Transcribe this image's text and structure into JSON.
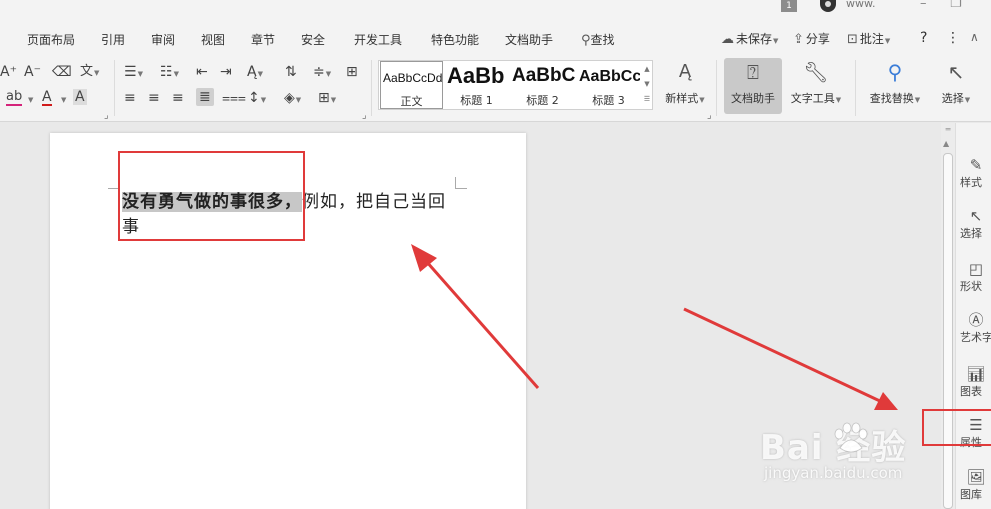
{
  "titlebar": {
    "tab_count": "1",
    "user_label": "www.",
    "minimize": "–",
    "restore": "❐"
  },
  "menu": {
    "items": [
      "页面布局",
      "引用",
      "审阅",
      "视图",
      "章节",
      "安全",
      "开发工具",
      "特色功能",
      "文档助手"
    ],
    "search_label": "查找",
    "save_status": "未保存",
    "share": "分享",
    "comment": "批注",
    "help": "?",
    "more": "⋮",
    "collapse": "∧"
  },
  "ribbon": {
    "font_tools": [
      "A⁺",
      "A⁻",
      "◇",
      "wén"
    ],
    "font_tools_row2": [
      "ab",
      "A",
      "A"
    ],
    "styles": [
      {
        "preview": "AaBbCcDd",
        "name": "正文",
        "selected": true
      },
      {
        "preview": "AaBb",
        "name": "标题 1"
      },
      {
        "preview": "AaBbC",
        "name": "标题 2"
      },
      {
        "preview": "AaBbCc",
        "name": "标题 3"
      }
    ],
    "new_style": "新样式",
    "doc_assistant": "文档助手",
    "text_tools": "文字工具",
    "find_replace": "查找替换",
    "select": "选择"
  },
  "document": {
    "bold_text": "没有勇气做的事很多，",
    "normal_text": "例如，把自己当回事"
  },
  "sidebar": {
    "items": [
      {
        "label": "样式",
        "icon": "pencil-icon"
      },
      {
        "label": "选择",
        "icon": "cursor-icon"
      },
      {
        "label": "形状",
        "icon": "shapes-icon"
      },
      {
        "label": "艺术字",
        "icon": "art-text-icon"
      },
      {
        "label": "图表",
        "icon": "chart-icon"
      },
      {
        "label": "属性",
        "icon": "sliders-icon"
      },
      {
        "label": "图库",
        "icon": "image-icon"
      }
    ]
  },
  "watermark": {
    "brand": "Bai  经验",
    "url": "jingyan.baidu.com"
  },
  "colors": {
    "annotation_red": "#e03a3a",
    "highlight_gray": "#c7c7c7",
    "chrome_bg": "#f3f3f3"
  }
}
